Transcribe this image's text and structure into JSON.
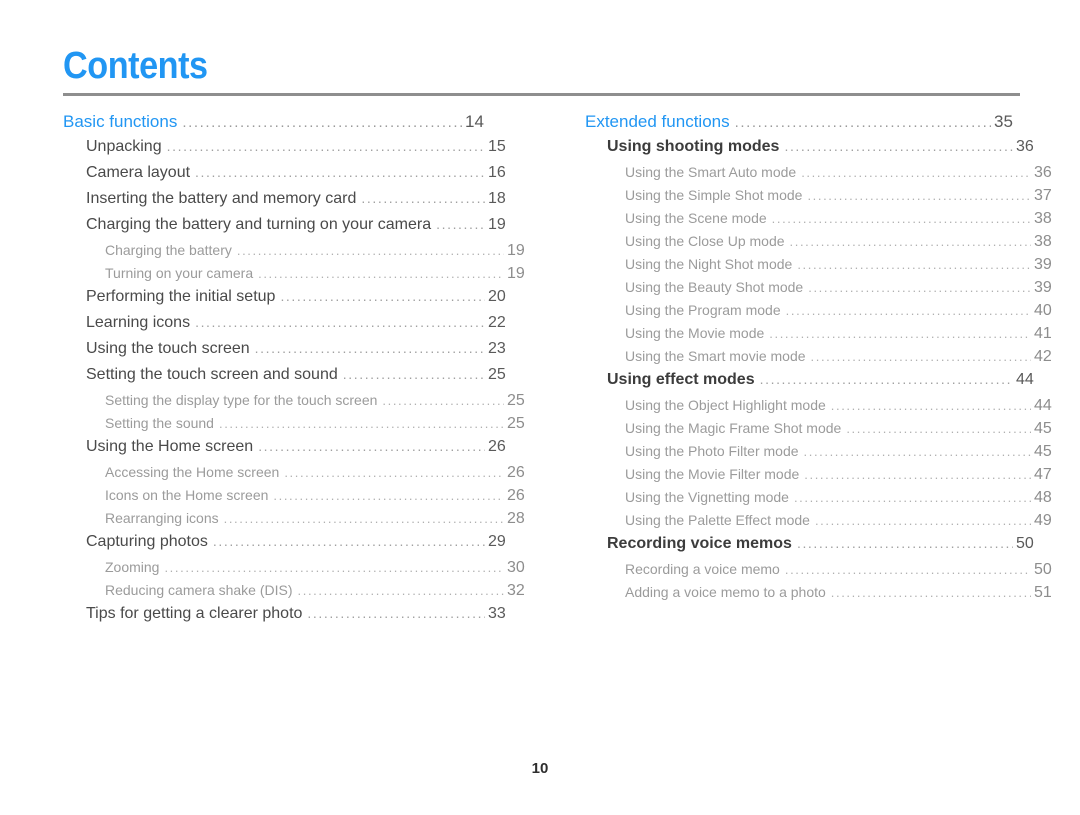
{
  "document": {
    "title": "Contents",
    "folio": "10",
    "accent_color": "#2196f3",
    "rule_color": "#8e8e8e"
  },
  "columns": {
    "left": {
      "entries": [
        {
          "level": "section",
          "label": "Basic functions",
          "page": "14"
        },
        {
          "level": "1",
          "label": "Unpacking",
          "page": "15"
        },
        {
          "level": "1",
          "label": "Camera layout",
          "page": "16"
        },
        {
          "level": "1",
          "label": "Inserting the battery and memory card",
          "page": "18"
        },
        {
          "level": "1",
          "label": "Charging the battery and turning on your camera",
          "page": "19"
        },
        {
          "level": "2",
          "label": "Charging the battery",
          "page": "19"
        },
        {
          "level": "2",
          "label": "Turning on your camera",
          "page": "19"
        },
        {
          "level": "1",
          "label": "Performing the initial setup",
          "page": "20"
        },
        {
          "level": "1",
          "label": "Learning icons",
          "page": "22"
        },
        {
          "level": "1",
          "label": "Using the touch screen",
          "page": "23"
        },
        {
          "level": "1",
          "label": "Setting the touch screen and sound",
          "page": "25"
        },
        {
          "level": "2",
          "label": "Setting the display type for the touch screen",
          "page": "25"
        },
        {
          "level": "2",
          "label": "Setting the sound",
          "page": "25"
        },
        {
          "level": "1",
          "label": "Using the Home screen",
          "page": "26"
        },
        {
          "level": "2",
          "label": "Accessing the Home screen",
          "page": "26"
        },
        {
          "level": "2",
          "label": "Icons on the Home screen",
          "page": "26"
        },
        {
          "level": "2",
          "label": "Rearranging icons",
          "page": "28"
        },
        {
          "level": "1",
          "label": "Capturing photos",
          "page": "29"
        },
        {
          "level": "2",
          "label": "Zooming",
          "page": "30"
        },
        {
          "level": "2",
          "label": "Reducing camera shake (DIS)",
          "page": "32"
        },
        {
          "level": "1",
          "label": "Tips for getting a clearer photo",
          "page": "33"
        }
      ]
    },
    "right": {
      "entries": [
        {
          "level": "section",
          "label": "Extended functions",
          "page": "35"
        },
        {
          "level": "1",
          "bold": true,
          "label": "Using shooting modes",
          "page": "36"
        },
        {
          "level": "2",
          "label": "Using the Smart Auto mode",
          "page": "36"
        },
        {
          "level": "2",
          "label": "Using the Simple Shot mode",
          "page": "37"
        },
        {
          "level": "2",
          "label": "Using the Scene mode",
          "page": "38"
        },
        {
          "level": "2",
          "label": "Using the Close Up mode",
          "page": "38"
        },
        {
          "level": "2",
          "label": "Using the Night Shot mode",
          "page": "39"
        },
        {
          "level": "2",
          "label": "Using the Beauty Shot mode",
          "page": "39"
        },
        {
          "level": "2",
          "label": "Using the Program mode",
          "page": "40"
        },
        {
          "level": "2",
          "label": "Using the Movie mode",
          "page": "41"
        },
        {
          "level": "2",
          "label": "Using the Smart movie mode",
          "page": "42"
        },
        {
          "level": "1",
          "bold": true,
          "label": "Using effect modes",
          "page": "44"
        },
        {
          "level": "2",
          "label": "Using the Object Highlight mode",
          "page": "44"
        },
        {
          "level": "2",
          "label": "Using the Magic Frame Shot mode",
          "page": "45"
        },
        {
          "level": "2",
          "label": "Using the Photo Filter mode",
          "page": "45"
        },
        {
          "level": "2",
          "label": "Using the Movie Filter mode",
          "page": "47"
        },
        {
          "level": "2",
          "label": "Using the Vignetting mode",
          "page": "48"
        },
        {
          "level": "2",
          "label": "Using the Palette Effect mode",
          "page": "49"
        },
        {
          "level": "1",
          "bold": true,
          "label": "Recording voice memos",
          "page": "50"
        },
        {
          "level": "2",
          "label": "Recording a voice memo",
          "page": "50"
        },
        {
          "level": "2",
          "label": "Adding a voice memo to a photo",
          "page": "51"
        }
      ]
    }
  }
}
